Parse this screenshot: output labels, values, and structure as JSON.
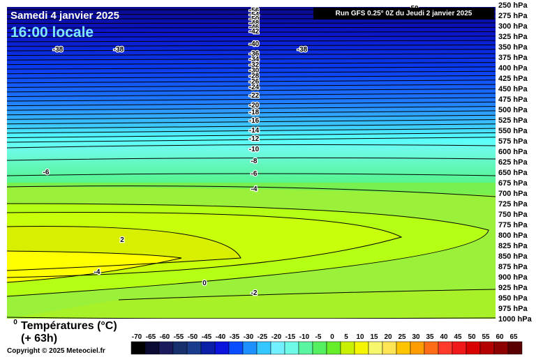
{
  "header": {
    "date": "Samedi 4 janvier 2025",
    "time": "16:00 locale",
    "run": "Run GFS 0.25° 0Z du Jeudi 2 janvier 2025"
  },
  "variable": {
    "title": "Températures (°C)",
    "lead": "(+ 63h)"
  },
  "copyright": "Copyright © 2025 Meteociel.fr",
  "chart_data": {
    "type": "contour",
    "x_axis": "position along cross-section (no labels)",
    "y_axis": {
      "unit": "hPa",
      "ticks": [
        250,
        275,
        300,
        325,
        350,
        375,
        400,
        425,
        450,
        475,
        500,
        525,
        550,
        575,
        600,
        625,
        650,
        675,
        700,
        725,
        750,
        775,
        800,
        825,
        850,
        875,
        900,
        925,
        950,
        975,
        1000
      ],
      "tick_labels": [
        "250 hPa",
        "275 hPa",
        "300 hPa",
        "325 hPa",
        "350 hPa",
        "375 hPa",
        "400 hPa",
        "425 hPa",
        "450 hPa",
        "475 hPa",
        "500 hPa",
        "525 hPa",
        "550 hPa",
        "575 hPa",
        "600 hPa",
        "625 hPa",
        "650 hPa",
        "675 hPa",
        "700 hPa",
        "725 hPa",
        "750 hPa",
        "775 hPa",
        "800 hPa",
        "825 hPa",
        "850 hPa",
        "875 hPa",
        "900 hPa",
        "925 hPa",
        "950 hPa",
        "975 hPa",
        "1000 hPa"
      ],
      "range": [
        250,
        1000
      ],
      "inverted": true
    },
    "contour_labels_center_column": [
      "-56",
      "-54",
      "-50",
      "-48",
      "-46",
      "-42",
      "-40",
      "-36",
      "-34",
      "-32",
      "-30",
      "-28",
      "-26",
      "-24",
      "-22",
      "-20",
      "-18",
      "-16",
      "-14",
      "-12",
      "-10",
      "-8",
      "-6",
      "-4",
      "-2"
    ],
    "other_labels": [
      "-38",
      "-38",
      "-38",
      "-6",
      "2",
      "-4",
      "0",
      "50",
      "0"
    ],
    "colorbar": {
      "labels": [
        "-70",
        "-65",
        "-60",
        "-55",
        "-50",
        "-45",
        "-40",
        "-35",
        "-30",
        "-25",
        "-20",
        "-15",
        "-10",
        "-5",
        "0",
        "5",
        "10",
        "15",
        "20",
        "25",
        "30",
        "35",
        "40",
        "45",
        "50",
        "55",
        "60",
        "65"
      ],
      "colors": [
        "#000000",
        "#0a0a33",
        "#1a1a5c",
        "#16306e",
        "#1a3c8c",
        "#0b1fa6",
        "#0a14dc",
        "#0a4cff",
        "#1e90ff",
        "#35c7ff",
        "#73f0ff",
        "#6efae6",
        "#5af5a0",
        "#55f060",
        "#66ee2a",
        "#c8f000",
        "#f5f500",
        "#f7f76e",
        "#ffe455",
        "#ffc400",
        "#ff9c00",
        "#ff6c18",
        "#ff3a2a",
        "#f01818",
        "#d80000",
        "#b40000",
        "#8c0000",
        "#5a0000"
      ]
    },
    "colors": {
      "upper_deep": "#0a14c8",
      "mid_blue": "#1e90ff",
      "cyan": "#55ffff",
      "green": "#55f078",
      "yellowgreen": "#b4ff14",
      "yellow": "#ffff00"
    }
  }
}
